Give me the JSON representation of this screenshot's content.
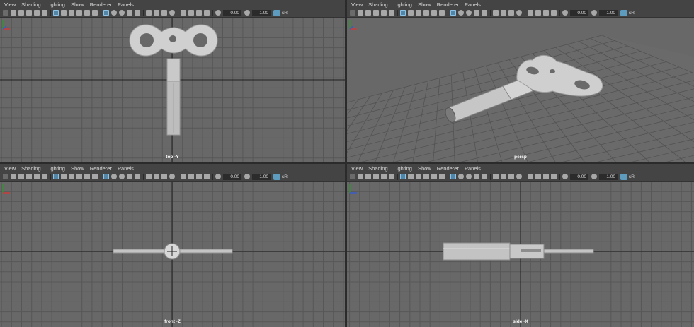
{
  "menu": [
    "View",
    "Shading",
    "Lighting",
    "Show",
    "Renderer",
    "Panels"
  ],
  "toolbar": {
    "field1": "0.00",
    "field2": "1.00",
    "color_label": "sR"
  },
  "panels": [
    {
      "camera": "top -Y"
    },
    {
      "camera": "persp"
    },
    {
      "camera": "front -Z"
    },
    {
      "camera": "side -X"
    }
  ],
  "colors": {
    "bg": "#686868",
    "grid": "#575757",
    "axis_line": "#1a1a1a",
    "model": "#c8c8c8",
    "menubar": "#444444"
  },
  "icons": [
    "grid-icon",
    "camera-icon",
    "shaded-icon",
    "wireframe-icon",
    "light-icon",
    "texture-icon",
    "isolate-icon",
    "exposure-icon",
    "gamma-icon",
    "colorspace-icon"
  ]
}
